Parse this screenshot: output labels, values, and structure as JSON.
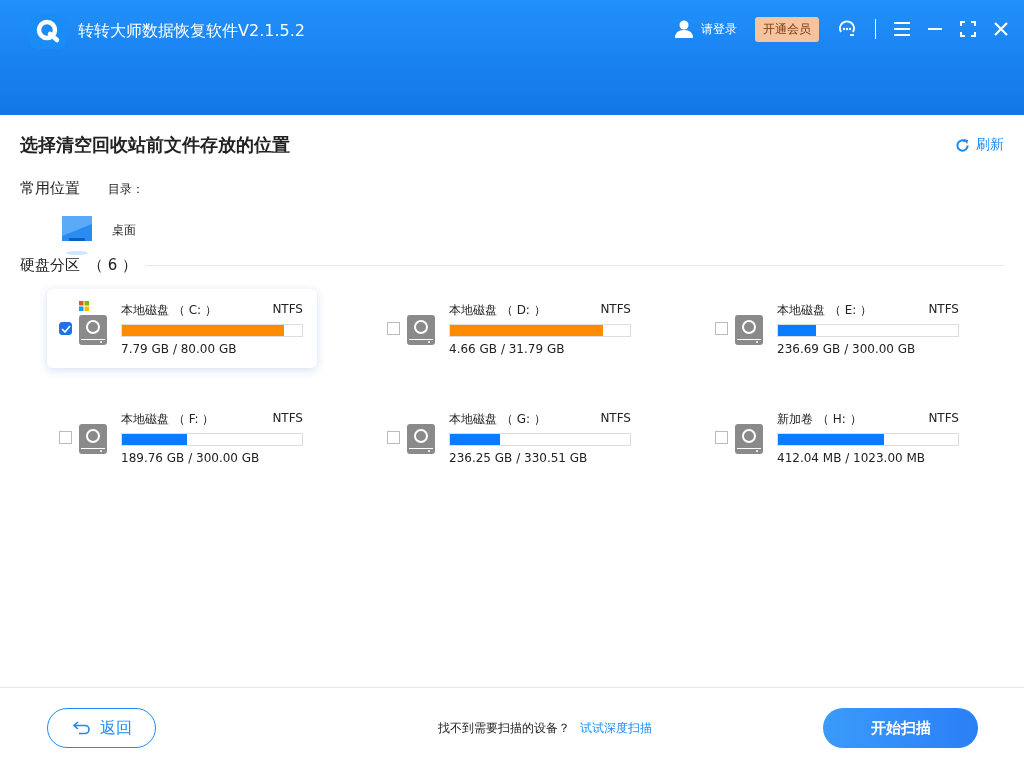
{
  "window": {
    "title": "转转大师数据恢复软件V2.1.5.2",
    "login": "请登录",
    "vip": "开通会员"
  },
  "heading": "选择清空回收站前文件存放的位置",
  "refresh": "刷新",
  "common": {
    "label": "常用位置",
    "dir_label": "目录：",
    "items": [
      {
        "name": "桌面"
      }
    ]
  },
  "partitions": {
    "label": "硬盘分区",
    "count": "（ 6 ）",
    "drives": [
      {
        "name": "本地磁盘 （ C: ）",
        "fs": "NTFS",
        "usage": "7.79 GB / 80.00 GB",
        "level": 0.9,
        "color": "#ff8c00",
        "checked": true,
        "system": true
      },
      {
        "name": "本地磁盘 （ D: ）",
        "fs": "NTFS",
        "usage": "4.66 GB / 31.79 GB",
        "level": 0.85,
        "color": "#ff8c00",
        "checked": false,
        "system": false
      },
      {
        "name": "本地磁盘 （ E: ）",
        "fs": "NTFS",
        "usage": "236.69 GB / 300.00 GB",
        "level": 0.21,
        "color": "#0a7cff",
        "checked": false,
        "system": false
      },
      {
        "name": "本地磁盘 （ F: ）",
        "fs": "NTFS",
        "usage": "189.76 GB / 300.00 GB",
        "level": 0.36,
        "color": "#0a7cff",
        "checked": false,
        "system": false
      },
      {
        "name": "本地磁盘 （ G: ）",
        "fs": "NTFS",
        "usage": "236.25 GB / 330.51 GB",
        "level": 0.28,
        "color": "#0a7cff",
        "checked": false,
        "system": false
      },
      {
        "name": "新加卷 （ H: ）",
        "fs": "NTFS",
        "usage": "412.04 MB / 1023.00 MB",
        "level": 0.59,
        "color": "#0a7cff",
        "checked": false,
        "system": false
      }
    ]
  },
  "footer": {
    "back": "返回",
    "hint": "找不到需要扫描的设备？",
    "link": "试试深度扫描",
    "start": "开始扫描"
  }
}
